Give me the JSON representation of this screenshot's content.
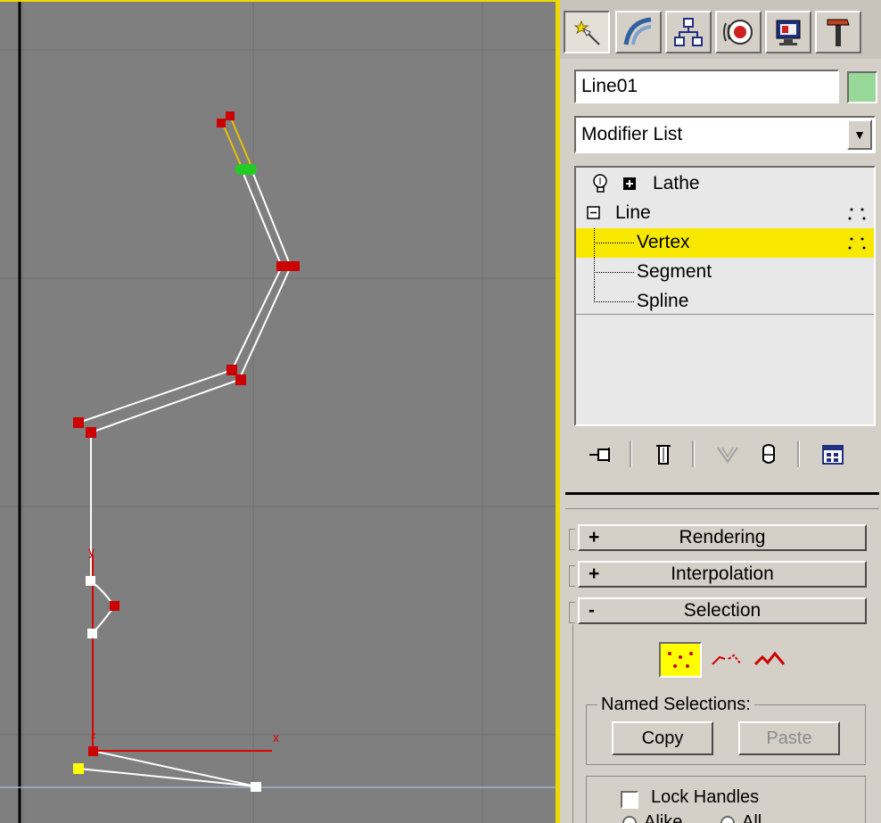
{
  "viewport": {
    "axis_labels": {
      "y": "y",
      "x": "x",
      "z": "z"
    }
  },
  "panel": {
    "tabs": [
      {
        "icon": "create-icon",
        "active": true
      },
      {
        "icon": "modify-icon",
        "active": false
      },
      {
        "icon": "hierarchy-icon",
        "active": false
      },
      {
        "icon": "motion-icon",
        "active": false
      },
      {
        "icon": "display-icon",
        "active": false
      },
      {
        "icon": "utilities-icon",
        "active": false
      }
    ],
    "object_name": "Line01",
    "object_color": "#98d898",
    "modifier_list": "Modifier List",
    "stack": {
      "lathe": "Lathe",
      "line": "Line",
      "vertex": "Vertex",
      "segment": "Segment",
      "spline": "Spline"
    },
    "rollouts": {
      "rendering": {
        "sign": "+",
        "title": "Rendering"
      },
      "interpolation": {
        "sign": "+",
        "title": "Interpolation"
      },
      "selection": {
        "sign": "-",
        "title": "Selection"
      }
    },
    "selection": {
      "named_selections_label": "Named Selections:",
      "copy_label": "Copy",
      "paste_label": "Paste",
      "lock_handles_label": "Lock Handles",
      "radio_1": "Alike",
      "radio_2": "All"
    },
    "colors": {
      "accent_yellow": "#ffff00",
      "highlight_row": "#f8e800",
      "vertex_red": "#cc0000",
      "vertex_selected_green": "#22cc22"
    }
  }
}
